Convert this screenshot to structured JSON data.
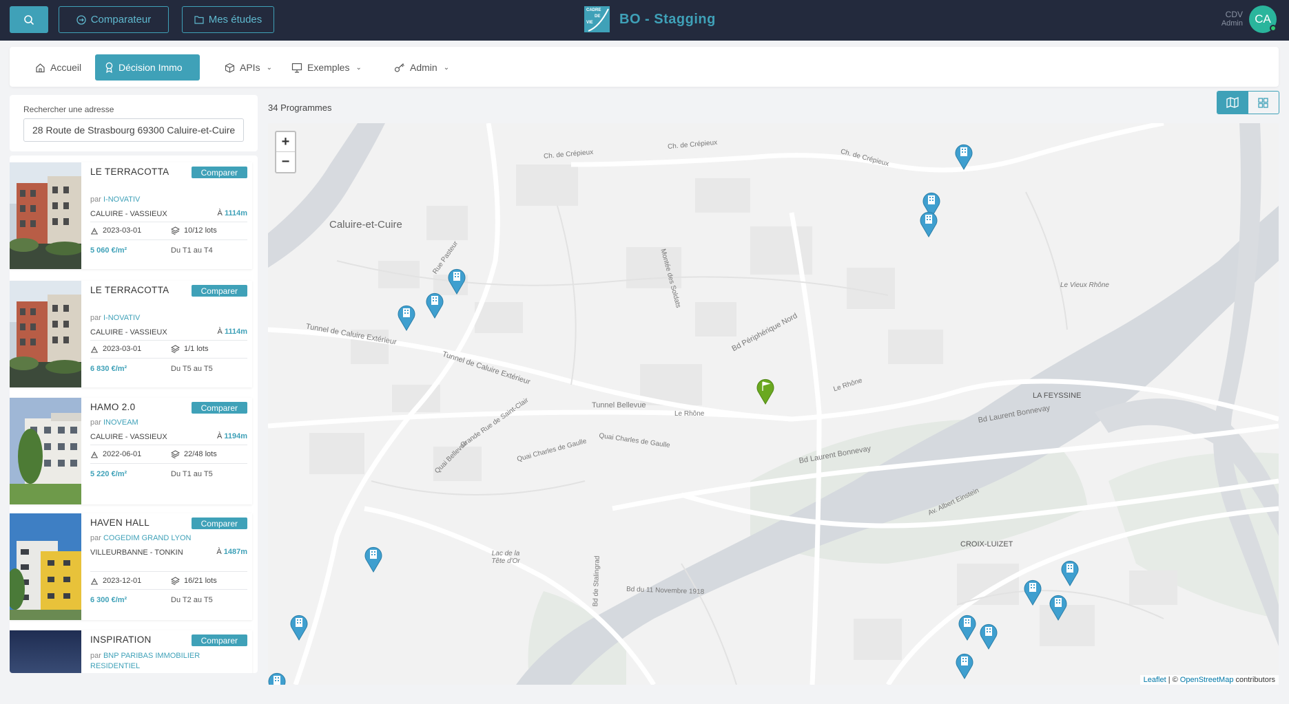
{
  "header": {
    "comparator_label": "Comparateur",
    "studies_label": "Mes études",
    "brand_logo_lines": [
      "CADRE",
      "DE",
      "VIE"
    ],
    "brand_title": "BO - Stagging",
    "user_name": "CDV",
    "user_role": "Admin",
    "avatar_initials": "CA"
  },
  "nav": {
    "home": "Accueil",
    "decision": "Décision Immo",
    "apis": "APIs",
    "examples": "Exemples",
    "admin": "Admin"
  },
  "search": {
    "label": "Rechercher une adresse",
    "value": "28 Route de Strasbourg 69300 Caluire-et-Cuire"
  },
  "results": {
    "count_label": "34 Programmes"
  },
  "programs": [
    {
      "title": "LE TERRACOTTA",
      "compare_label": "Comparer",
      "by": "par",
      "developer": "I-NOVATIV",
      "location": "CALUIRE - VASSIEUX",
      "dist_prefix": "À",
      "distance": "1114m",
      "date": "2023-03-01",
      "lots": "10/12 lots",
      "price": "5 060 €/m²",
      "range": "Du T1 au T4"
    },
    {
      "title": "LE TERRACOTTA",
      "compare_label": "Comparer",
      "by": "par",
      "developer": "I-NOVATIV",
      "location": "CALUIRE - VASSIEUX",
      "dist_prefix": "À",
      "distance": "1114m",
      "date": "2023-03-01",
      "lots": "1/1 lots",
      "price": "6 830 €/m²",
      "range": "Du T5 au T5"
    },
    {
      "title": "HAMO 2.0",
      "compare_label": "Comparer",
      "by": "par",
      "developer": "INOVEAM",
      "location": "CALUIRE - VASSIEUX",
      "dist_prefix": "À",
      "distance": "1194m",
      "date": "2022-06-01",
      "lots": "22/48 lots",
      "price": "5 220 €/m²",
      "range": "Du T1 au T5"
    },
    {
      "title": "HAVEN HALL",
      "compare_label": "Comparer",
      "by": "par",
      "developer": "COGEDIM GRAND LYON",
      "location": "VILLEURBANNE - TONKIN",
      "dist_prefix": "À",
      "distance": "1487m",
      "date": "2023-12-01",
      "lots": "16/21 lots",
      "price": "6 300 €/m²",
      "range": "Du T2 au T5"
    },
    {
      "title": "INSPIRATION",
      "compare_label": "Comparer",
      "by": "par",
      "developer": "BNP PARIBAS IMMOBILIER RESIDENTIEL"
    }
  ],
  "map": {
    "zoom_in": "+",
    "zoom_out": "−",
    "attribution_leaflet": "Leaflet",
    "attribution_sep": "| ©",
    "attribution_osm": "OpenStreetMap",
    "attribution_tail": "contributors",
    "labels": {
      "city": "Caluire-et-Cuire",
      "peripherique": "Bd Périphérique Nord",
      "tunnel_caluire": "Tunnel de Caluire Extérieur",
      "tunnel_caluire2": "Tunnel de Caluire Extérieur",
      "tunnel_bellevue": "Tunnel Bellevue",
      "rhone1": "Le Rhône",
      "rhone2": "Le Rhône",
      "laurent": "Bd Laurent Bonnevay",
      "laurent2": "Bd Laurent Bonnevay",
      "feyssine": "LA FEYSSINE",
      "croix": "CROIX-LUIZET",
      "crepieux": "Ch. de Crépieux",
      "crepieux2": "Ch. de Crépieux",
      "crepieux3": "Ch. de Crépieux",
      "soldats": "Montée des Soldats",
      "gaulle": "Quai Charles de Gaulle",
      "gaulle2": "Quai Charles de Gaulle",
      "bellevue": "Quai Bellevue",
      "rue_pasteur": "Rue Pasteur",
      "einstein": "Av. Albert Einstein",
      "lac": "Lac de la Tête d'Or",
      "stalingrad": "Bd de Stalingrad",
      "novembre": "Bd du 11 Novembre 1918",
      "clair": "Grande Rue de Saint-Clair",
      "vieux": "Le Vieux Rhône"
    }
  },
  "colors": {
    "topbar": "#232a3d",
    "accent": "#3fa1b8",
    "marker_program": "#3f9fcf",
    "marker_target": "#6aa820"
  },
  "icons": {
    "search": "search-icon",
    "compare": "compare-icon",
    "folder": "folder-icon",
    "home": "home-icon",
    "award": "award-icon",
    "box": "box-icon",
    "monitor": "monitor-icon",
    "key": "key-icon",
    "calendar": "calendar-icon",
    "lots": "lots-icon",
    "map_view": "map-view-icon",
    "grid_view": "grid-view-icon",
    "building_marker": "building-marker-icon",
    "flag_marker": "flag-marker-icon"
  }
}
